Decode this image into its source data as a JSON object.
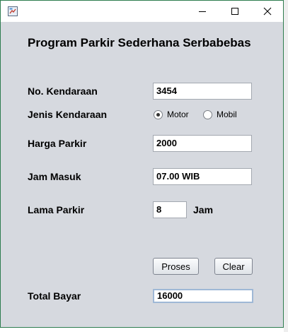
{
  "window": {
    "title": ""
  },
  "heading": "Program Parkir Sederhana Serbabebas",
  "form": {
    "no_kendaraan": {
      "label": "No. Kendaraan",
      "value": "3454"
    },
    "jenis_kendaraan": {
      "label": "Jenis Kendaraan",
      "options": [
        {
          "label": "Motor",
          "selected": true
        },
        {
          "label": "Mobil",
          "selected": false
        }
      ]
    },
    "harga_parkir": {
      "label": "Harga Parkir",
      "value": "2000"
    },
    "jam_masuk": {
      "label": "Jam Masuk",
      "value": "07.00 WIB"
    },
    "lama_parkir": {
      "label": "Lama Parkir",
      "value": "8",
      "unit": "Jam"
    },
    "total_bayar": {
      "label": "Total Bayar",
      "value": "16000"
    }
  },
  "buttons": {
    "proses": "Proses",
    "clear": "Clear"
  }
}
